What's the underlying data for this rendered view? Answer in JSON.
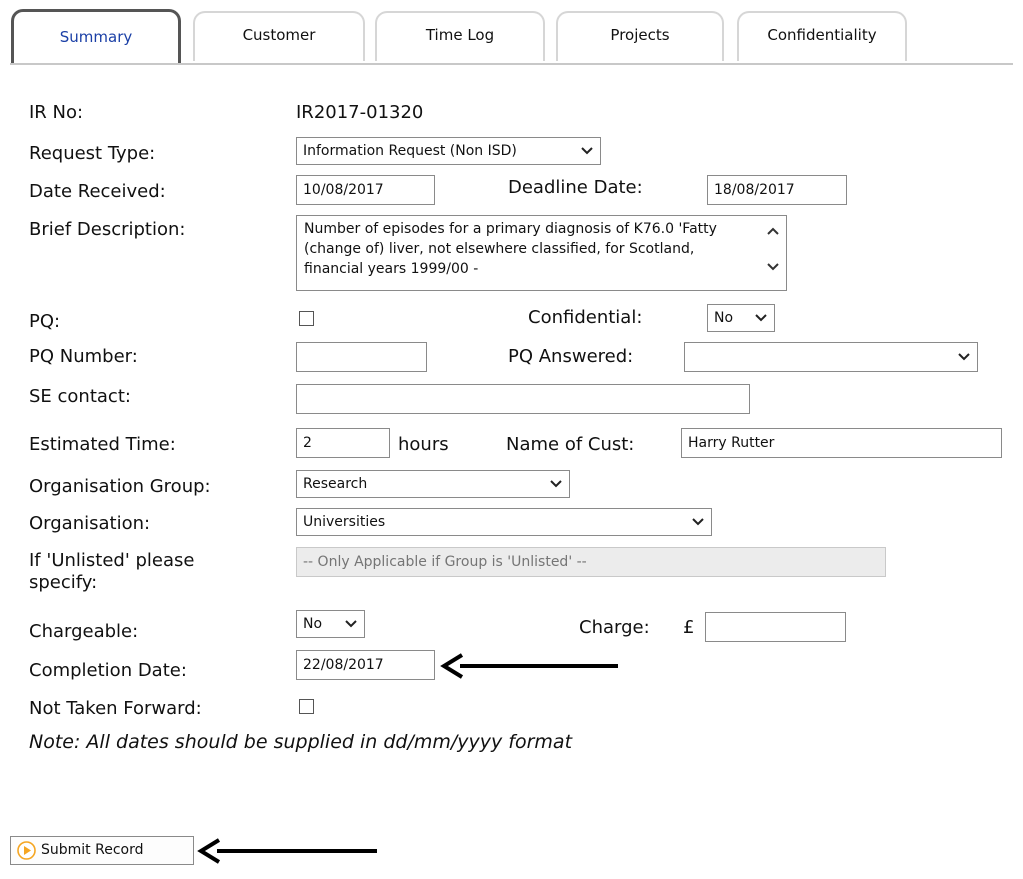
{
  "tabs": [
    {
      "label": "Summary"
    },
    {
      "label": "Customer"
    },
    {
      "label": "Time Log"
    },
    {
      "label": "Projects"
    },
    {
      "label": "Confidentiality"
    }
  ],
  "form": {
    "ir_no_label": "IR No:",
    "ir_no_value": "IR2017-01320",
    "request_type_label": "Request Type:",
    "request_type_value": "Information Request (Non ISD)",
    "date_received_label": "Date Received:",
    "date_received_value": "10/08/2017",
    "deadline_label": "Deadline Date:",
    "deadline_value": "18/08/2017",
    "brief_description_label": "Brief Description:",
    "brief_description_value": "Number of episodes for a primary diagnosis of K76.0 'Fatty (change of) liver, not elsewhere classified, for Scotland, financial years 1999/00 -",
    "pq_label": "PQ:",
    "confidential_label": "Confidential:",
    "confidential_value": "No",
    "pq_number_label": "PQ Number:",
    "pq_number_value": "",
    "pq_answered_label": "PQ Answered:",
    "pq_answered_value": "",
    "se_contact_label": "SE contact:",
    "se_contact_value": "",
    "estimated_time_label": "Estimated Time:",
    "estimated_time_value": "2",
    "hours_label": "hours",
    "name_of_cust_label": "Name of Cust:",
    "name_of_cust_value": "Harry Rutter",
    "org_group_label": "Organisation Group:",
    "org_group_value": "Research",
    "organisation_label": "Organisation:",
    "organisation_value": "Universities",
    "unlisted_label": "If 'Unlisted' please specify:",
    "unlisted_placeholder": "-- Only Applicable if Group is 'Unlisted' --",
    "chargeable_label": "Chargeable:",
    "chargeable_value": "No",
    "charge_label": "Charge:",
    "currency_symbol": "£",
    "charge_value": "",
    "completion_date_label": "Completion Date:",
    "completion_date_value": "22/08/2017",
    "not_taken_forward_label": "Not Taken Forward:",
    "note": "Note: All dates should be supplied in dd/mm/yyyy format"
  },
  "submit": {
    "label": "Submit Record",
    "icon": "play-circle-icon",
    "icon_color": "#f5a623"
  },
  "annotations": {
    "arrow_icon": "left-arrow-icon",
    "arrow_color": "#000000"
  },
  "colors": {
    "active_tab_text": "#1a3fa6",
    "tab_border": "#d6d6d6",
    "active_tab_border": "#555555"
  }
}
